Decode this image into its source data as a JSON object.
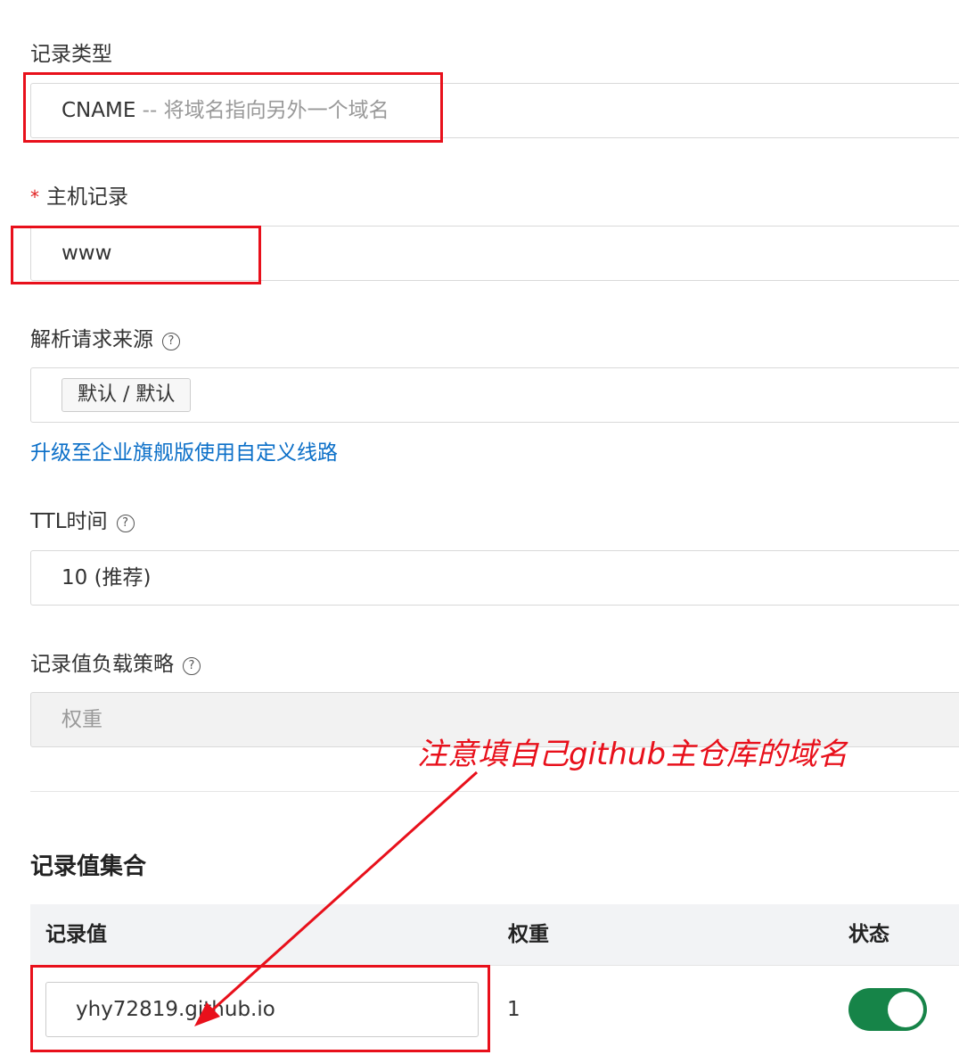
{
  "record_type": {
    "label": "记录类型",
    "value": "CNAME",
    "hint": " -- 将域名指向另外一个域名"
  },
  "host_record": {
    "required_mark": "*",
    "label": "主机记录",
    "value": "www"
  },
  "resolve_source": {
    "label": "解析请求来源",
    "help": "?",
    "tag": "默认 / 默认",
    "upgrade_link": "升级至企业旗舰版使用自定义线路"
  },
  "ttl": {
    "label": "TTL时间",
    "help": "?",
    "value": "10 (推荐)"
  },
  "load_strategy": {
    "label": "记录值负载策略",
    "help": "?",
    "value": "权重"
  },
  "record_set": {
    "title": "记录值集合",
    "columns": [
      "记录值",
      "权重",
      "状态"
    ],
    "rows": [
      {
        "value": "yhy72819.github.io",
        "weight": "1",
        "enabled": true
      }
    ]
  },
  "annotation": {
    "text": "注意填自己github主仓库的域名",
    "color": "#e8101b"
  },
  "colors": {
    "highlight": "#e8101b",
    "link": "#0b6fc8",
    "toggle_on": "#168448"
  }
}
